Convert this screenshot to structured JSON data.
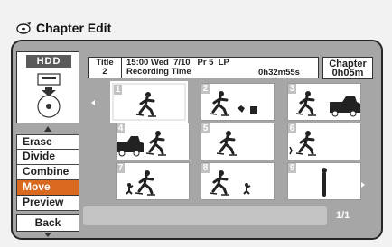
{
  "header": {
    "title": "Chapter Edit",
    "icon": "disc-edit-icon"
  },
  "device": {
    "label": "HDD"
  },
  "menu": {
    "items": [
      {
        "label": "Erase"
      },
      {
        "label": "Divide"
      },
      {
        "label": "Combine"
      },
      {
        "label": "Move",
        "selected": true
      },
      {
        "label": "Preview"
      }
    ],
    "back_label": "Back"
  },
  "info": {
    "title_label": "Title",
    "title_number": "2",
    "line1": "15:00 Wed  7/10   Pr 5  LP",
    "line2_label": "Recording Time",
    "recording_time": "0h32m55s"
  },
  "chapter": {
    "label": "Chapter",
    "time": "0h05m"
  },
  "thumbnails": [
    {
      "number": "1",
      "selected": true
    },
    {
      "number": "2"
    },
    {
      "number": "3"
    },
    {
      "number": "4"
    },
    {
      "number": "5"
    },
    {
      "number": "6"
    },
    {
      "number": "7"
    },
    {
      "number": "8"
    },
    {
      "number": "9"
    }
  ],
  "page": "1/1",
  "colors": {
    "accent": "#d8691f",
    "frame": "#a6a6a6"
  }
}
